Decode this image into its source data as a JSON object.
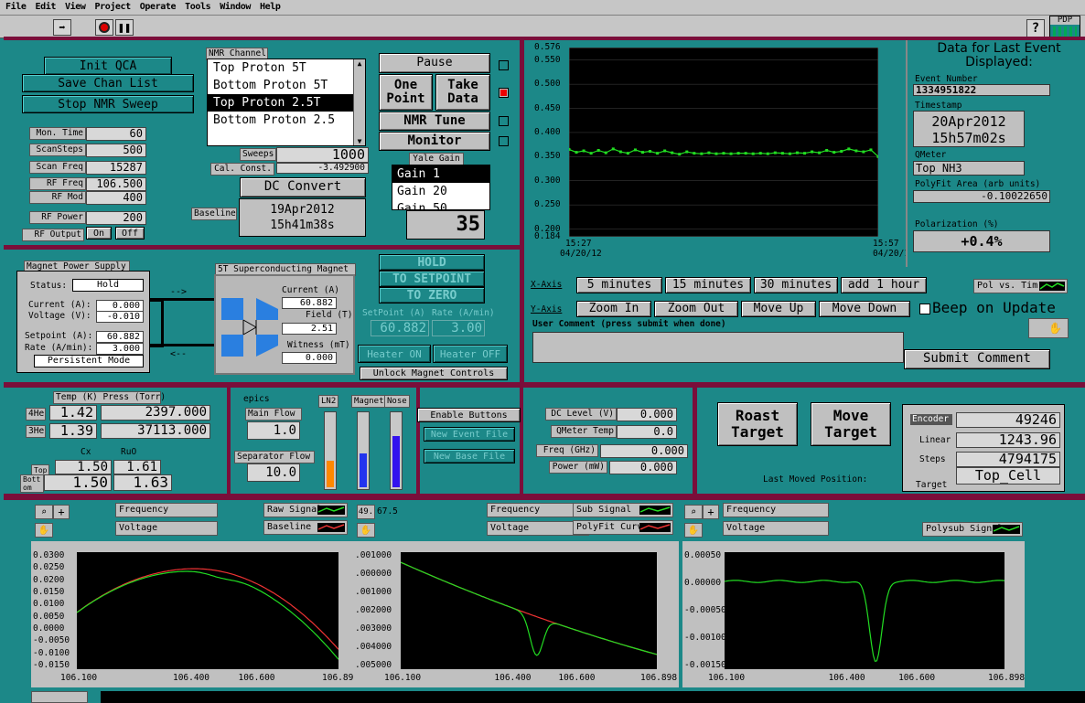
{
  "menu": [
    "File",
    "Edit",
    "View",
    "Project",
    "Operate",
    "Tools",
    "Window",
    "Help"
  ],
  "toolbar": {
    "logo": "PDP"
  },
  "qca": {
    "init": "Init QCA",
    "save": "Save Chan List",
    "stop": "Stop NMR Sweep"
  },
  "nmr_params": [
    {
      "label": "Mon. Time",
      "value": "60"
    },
    {
      "label": "ScanSteps",
      "value": "500"
    },
    {
      "label": "Scan Freq",
      "value": "15287"
    },
    {
      "label": "RF Freq",
      "value": "106.500"
    },
    {
      "label": "RF Mod",
      "value": "400"
    },
    {
      "label": "RF Power",
      "value": "200"
    }
  ],
  "rf_output": {
    "label": "RF Output",
    "on": "On",
    "off": "Off"
  },
  "nmr_channel": {
    "title": "NMR Channel",
    "items": [
      "Top Proton 5T",
      "Bottom Proton 5T",
      "Top Proton 2.5T",
      "Bottom Proton 2.5"
    ],
    "selected": 2
  },
  "sweeps": {
    "label": "Sweeps",
    "value": "1000"
  },
  "cal_const": {
    "label": "Cal. Const.",
    "value": "-3.492900"
  },
  "dc_convert": "DC Convert",
  "baseline": {
    "label": "Baseline",
    "date": "19Apr2012",
    "time": "15h41m38s"
  },
  "controls": {
    "pause": "Pause",
    "one_point": "One Point",
    "take_data": "Take Data",
    "nmr_tune": "NMR Tune",
    "monitor": "Monitor"
  },
  "yale_gain": {
    "title": "Yale Gain",
    "items": [
      "Gain 1",
      "Gain 20",
      "Gain 50"
    ],
    "selected": 0,
    "display": "35"
  },
  "top_chart": {
    "type": "line",
    "yticks": [
      "0.576",
      "0.550",
      "0.500",
      "0.450",
      "0.400",
      "0.350",
      "0.300",
      "0.250",
      "0.200",
      "0.184"
    ],
    "ylim": [
      0.184,
      0.576
    ],
    "x_start": {
      "time": "15:27",
      "date": "04/20/12"
    },
    "x_end": {
      "time": "15:57",
      "date": "04/20/12"
    },
    "line_color": "#22dd22"
  },
  "chart_data": [
    {
      "type": "line",
      "y": [
        0.365,
        0.359,
        0.362,
        0.357,
        0.363,
        0.358,
        0.366,
        0.36,
        0.357,
        0.364,
        0.359,
        0.361,
        0.357,
        0.362,
        0.358,
        0.355,
        0.36,
        0.357,
        0.356,
        0.358,
        0.356,
        0.357,
        0.356,
        0.357,
        0.357,
        0.356,
        0.357,
        0.356,
        0.358,
        0.357,
        0.356,
        0.358,
        0.357,
        0.36,
        0.358,
        0.363,
        0.359,
        0.361,
        0.366,
        0.362,
        0.36,
        0.364,
        0.35
      ],
      "ylim": [
        0.184,
        0.576
      ]
    },
    {
      "type": "line",
      "x": [
        106.1,
        106.89
      ],
      "ylim": [
        -0.015,
        0.031
      ],
      "xticks": [
        "106.100",
        "106.400",
        "106.600",
        "106.89"
      ],
      "yticks": [
        "0.0300",
        "0.0250",
        "0.0200",
        "0.0150",
        "0.0100",
        "0.0050",
        "0.0000",
        "-0.0050",
        "-0.0100",
        "-0.0150"
      ]
    },
    {
      "type": "line",
      "x": [
        106.1,
        106.898
      ],
      "ylim": [
        -0.0053,
        0.00105
      ],
      "xticks": [
        "106.100",
        "106.400",
        "106.600",
        "106.898"
      ],
      "yticks": [
        ".001000",
        ".000000",
        ".001000",
        ".002000",
        ".003000",
        ".004000",
        ".005000"
      ]
    },
    {
      "type": "line",
      "x": [
        106.1,
        106.898
      ],
      "ylim": [
        -0.00165,
        0.00055
      ],
      "xticks": [
        "106.100",
        "106.400",
        "106.600",
        "106.898"
      ],
      "yticks": [
        "0.00050",
        "0.00000",
        "-0.00050",
        "-0.00100",
        "-0.00150"
      ]
    }
  ],
  "last_event": {
    "title": "Data for Last Event Displayed:",
    "event_number_label": "Event Number",
    "event_number": "1334951822",
    "timestamp_label": "Timestamp",
    "ts_date": "20Apr2012",
    "ts_time": "15h57m02s",
    "qmeter_label": "QMeter",
    "qmeter": "Top NH3",
    "polyfit_label": "PolyFit Area (arb units)",
    "polyfit": "-0.10022650",
    "polarization_label": "Polarization (%)",
    "polarization": "+0.4%"
  },
  "xaxis": {
    "label": "X-Axis",
    "buttons": [
      "5 minutes",
      "15 minutes",
      "30 minutes",
      "add 1 hour"
    ]
  },
  "yaxis": {
    "label": "Y-Axis",
    "buttons": [
      "Zoom In",
      "Zoom Out",
      "Move Up",
      "Move Down"
    ]
  },
  "pol_vs_time": "Pol vs. Tim",
  "beep": "Beep on Update",
  "user_comment": {
    "label": "User Comment (press submit when done)",
    "submit": "Submit Comment"
  },
  "magnet_ps": {
    "title": "Magnet Power Supply",
    "status_label": "Status:",
    "status": "Hold",
    "current_label": "Current (A):",
    "current": "0.000",
    "voltage_label": "Voltage (V):",
    "voltage": "-0.010",
    "setpoint_label": "Setpoint (A):",
    "setpoint": "60.882",
    "rate_label": "Rate (A/min):",
    "rate": "3.000",
    "mode": "Persistent Mode"
  },
  "sc_magnet": {
    "title": "5T Superconducting Magnet",
    "current_label": "Current (A)",
    "current": "60.882",
    "field_label": "Field (T)",
    "field": "2.51",
    "witness_label": "Witness (mT)",
    "witness": "0.000"
  },
  "magnet_controls": {
    "hold": "HOLD",
    "to_setpoint": "TO SETPOINT",
    "to_zero": "TO ZERO",
    "setpoint_label": "SetPoint (A)",
    "rate_label": "Rate (A/min)",
    "setpoint": "60.882",
    "rate": "3.00",
    "heater_on": "Heater ON",
    "heater_off": "Heater OFF",
    "unlock": "Unlock Magnet Controls"
  },
  "temps": {
    "title": "Temp (K)  Press (Torr)",
    "he4_label": "4He",
    "he4_temp": "1.42",
    "he4_press": "2397.000",
    "he3_label": "3He",
    "he3_temp": "1.39",
    "he3_press": "37113.000",
    "cx_label": "Cx",
    "ruo_label": "RuO",
    "top_label": "Top",
    "top_cx": "1.50",
    "top_ruo": "1.61",
    "bottom_label": "Bott om",
    "bottom_cx": "1.50",
    "bottom_ruo": "1.63"
  },
  "epics": {
    "title": "epics",
    "main_flow_label": "Main Flow",
    "main_flow": "1.0",
    "sep_flow_label": "Separator Flow",
    "sep_flow": "10.0"
  },
  "levels": [
    {
      "name": "LN2",
      "fraction": 0.35,
      "color": "#ff8800"
    },
    {
      "name": "Magnet",
      "fraction": 0.45,
      "color": "#2233ee"
    },
    {
      "name": "Nose",
      "fraction": 0.68,
      "color": "#3311ee"
    }
  ],
  "buttons_mid": {
    "enable": "Enable Buttons",
    "new_event": "New Event File",
    "new_base": "New Base File"
  },
  "meters": [
    {
      "label": "DC Level (V)",
      "value": "0.000"
    },
    {
      "label": "QMeter Temp",
      "value": "0.0"
    },
    {
      "label": "Freq (GHz)",
      "value": "0.000"
    },
    {
      "label": "Power (mW)",
      "value": "0.000"
    }
  ],
  "target": {
    "roast": "Roast Target",
    "move": "Move Target",
    "last_moved": "Last Moved Position:",
    "encoder_label": "Encoder",
    "encoder": "49246",
    "linear_label": "Linear",
    "linear": "1243.96",
    "steps_label": "Steps",
    "steps": "4794175",
    "target_label": "Target",
    "target": "Top_Cell"
  },
  "plot_legends": {
    "p1": {
      "frequency": "Frequency",
      "voltage": "Voltage",
      "raw": "Raw Signal",
      "baseline": "Baseline"
    },
    "p2": {
      "frequency": "Frequency",
      "voltage": "Voltage",
      "sub": "Sub Signal",
      "polyfit": "PolyFit Curve",
      "cursor": "49.",
      "cursor2": "67.5"
    },
    "p3": {
      "frequency": "Frequency",
      "voltage": "Voltage",
      "polysub": "Polysub Signal"
    }
  }
}
